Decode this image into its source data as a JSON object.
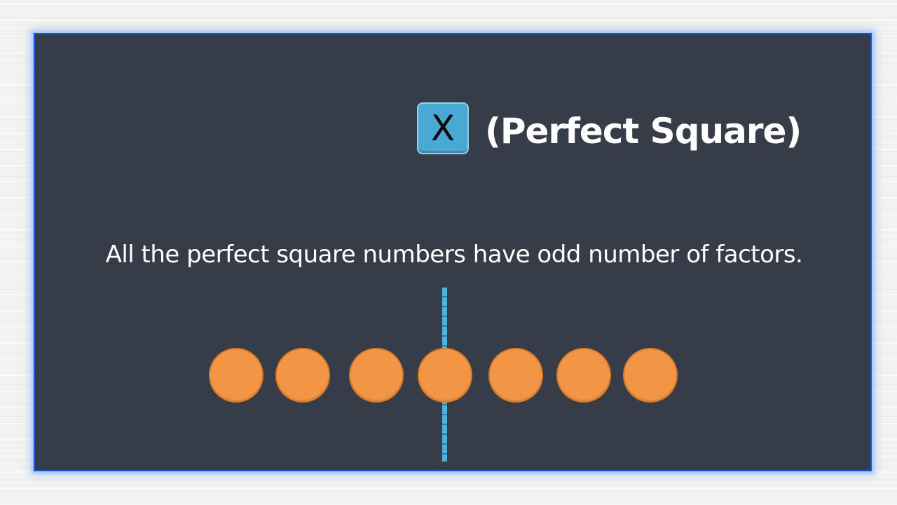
{
  "badge": {
    "letter": "X",
    "color": "#4aa9d2"
  },
  "heading": "(Perfect Square)",
  "statement": "All the perfect square numbers have odd number of factors.",
  "dots": {
    "count": 7,
    "color": "#f29545"
  },
  "divider_color": "#4fb3d9",
  "board_color": "#363d48"
}
